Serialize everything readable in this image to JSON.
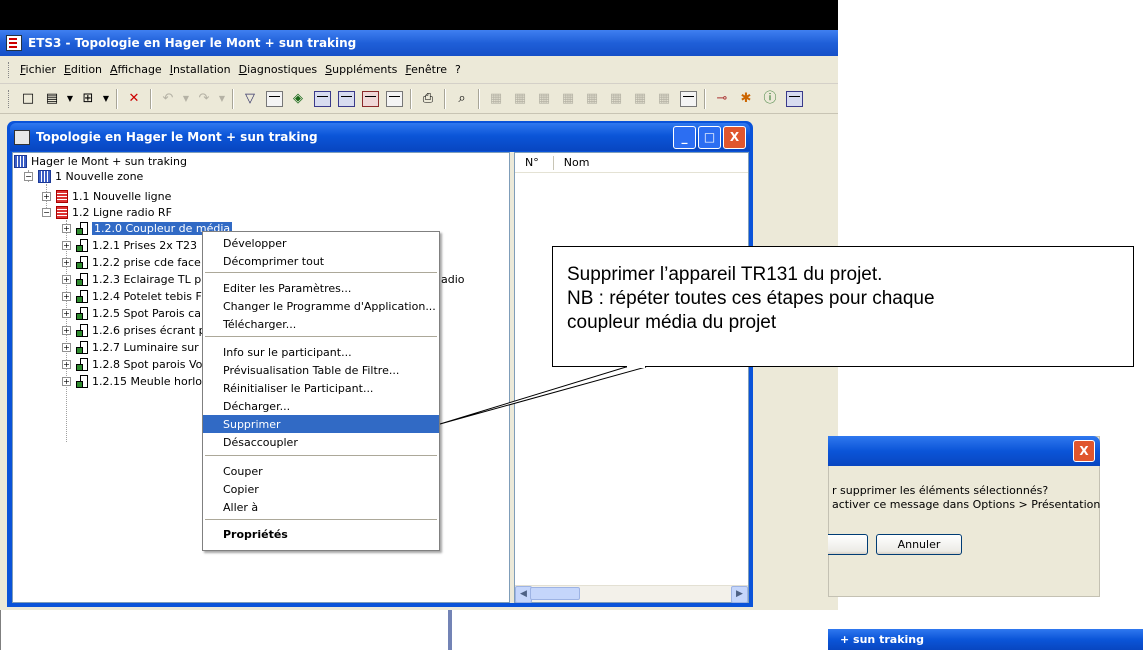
{
  "app": {
    "title": "ETS3 - Topologie en Hager le Mont + sun traking",
    "menu": [
      "Fichier",
      "Edition",
      "Affichage",
      "Installation",
      "Diagnostiques",
      "Suppléments",
      "Fenêtre",
      "?"
    ]
  },
  "child_window": {
    "title": "Topologie en Hager le Mont + sun traking",
    "min_label": "_",
    "max_label": "□",
    "close_label": "X"
  },
  "tree": {
    "root": "Hager le Mont + sun traking",
    "zone": "1 Nouvelle zone",
    "line1": "1.1 Nouvelle ligne",
    "line2": "1.2 Ligne radio RF",
    "devices": [
      "1.2.0 Coupleur de média",
      "1.2.1 Prises 2x T23",
      "1.2.2 prise cde face",
      "1.2.3 Eclairage TL p",
      "1.2.4 Potelet tebis F",
      "1.2.5 Spot Parois ca",
      "1.2.6 prises écrant p",
      "1.2.7 Luminaire sur",
      "1.2.8 Spot parois Vo",
      "1.2.15 Meuble horlo"
    ],
    "overflow_text": "adio"
  },
  "list": {
    "columns": [
      "N°",
      "Nom"
    ]
  },
  "context_menu": {
    "items": [
      "Développer",
      "Décomprimer tout",
      "Editer les Paramètres...",
      "Changer le Programme d'Application...",
      "Télécharger...",
      "Info sur le participant...",
      "Prévisualisation Table de Filtre...",
      "Réinitialiser le Participant...",
      "Décharger...",
      "Supprimer",
      "Désaccoupler",
      "Couper",
      "Copier",
      "Aller à",
      "Propriétés"
    ],
    "highlighted": "Supprimer"
  },
  "callout": {
    "line1": "Supprimer l’appareil TR131 du projet.",
    "line2": "NB : répéter toutes ces étapes pour chaque",
    "line3": "coupleur média du projet"
  },
  "dialog": {
    "message1": "r supprimer les éléments sélectionnés?",
    "message2": "activer ce message dans Options > Présentation",
    "cancel_label": "Annuler",
    "close_label": "X"
  },
  "bottom_window": {
    "title": "+ sun traking"
  },
  "colors": {
    "xp_blue": "#0b55d8",
    "selection": "#316ac5",
    "close_red": "#e0562e"
  }
}
